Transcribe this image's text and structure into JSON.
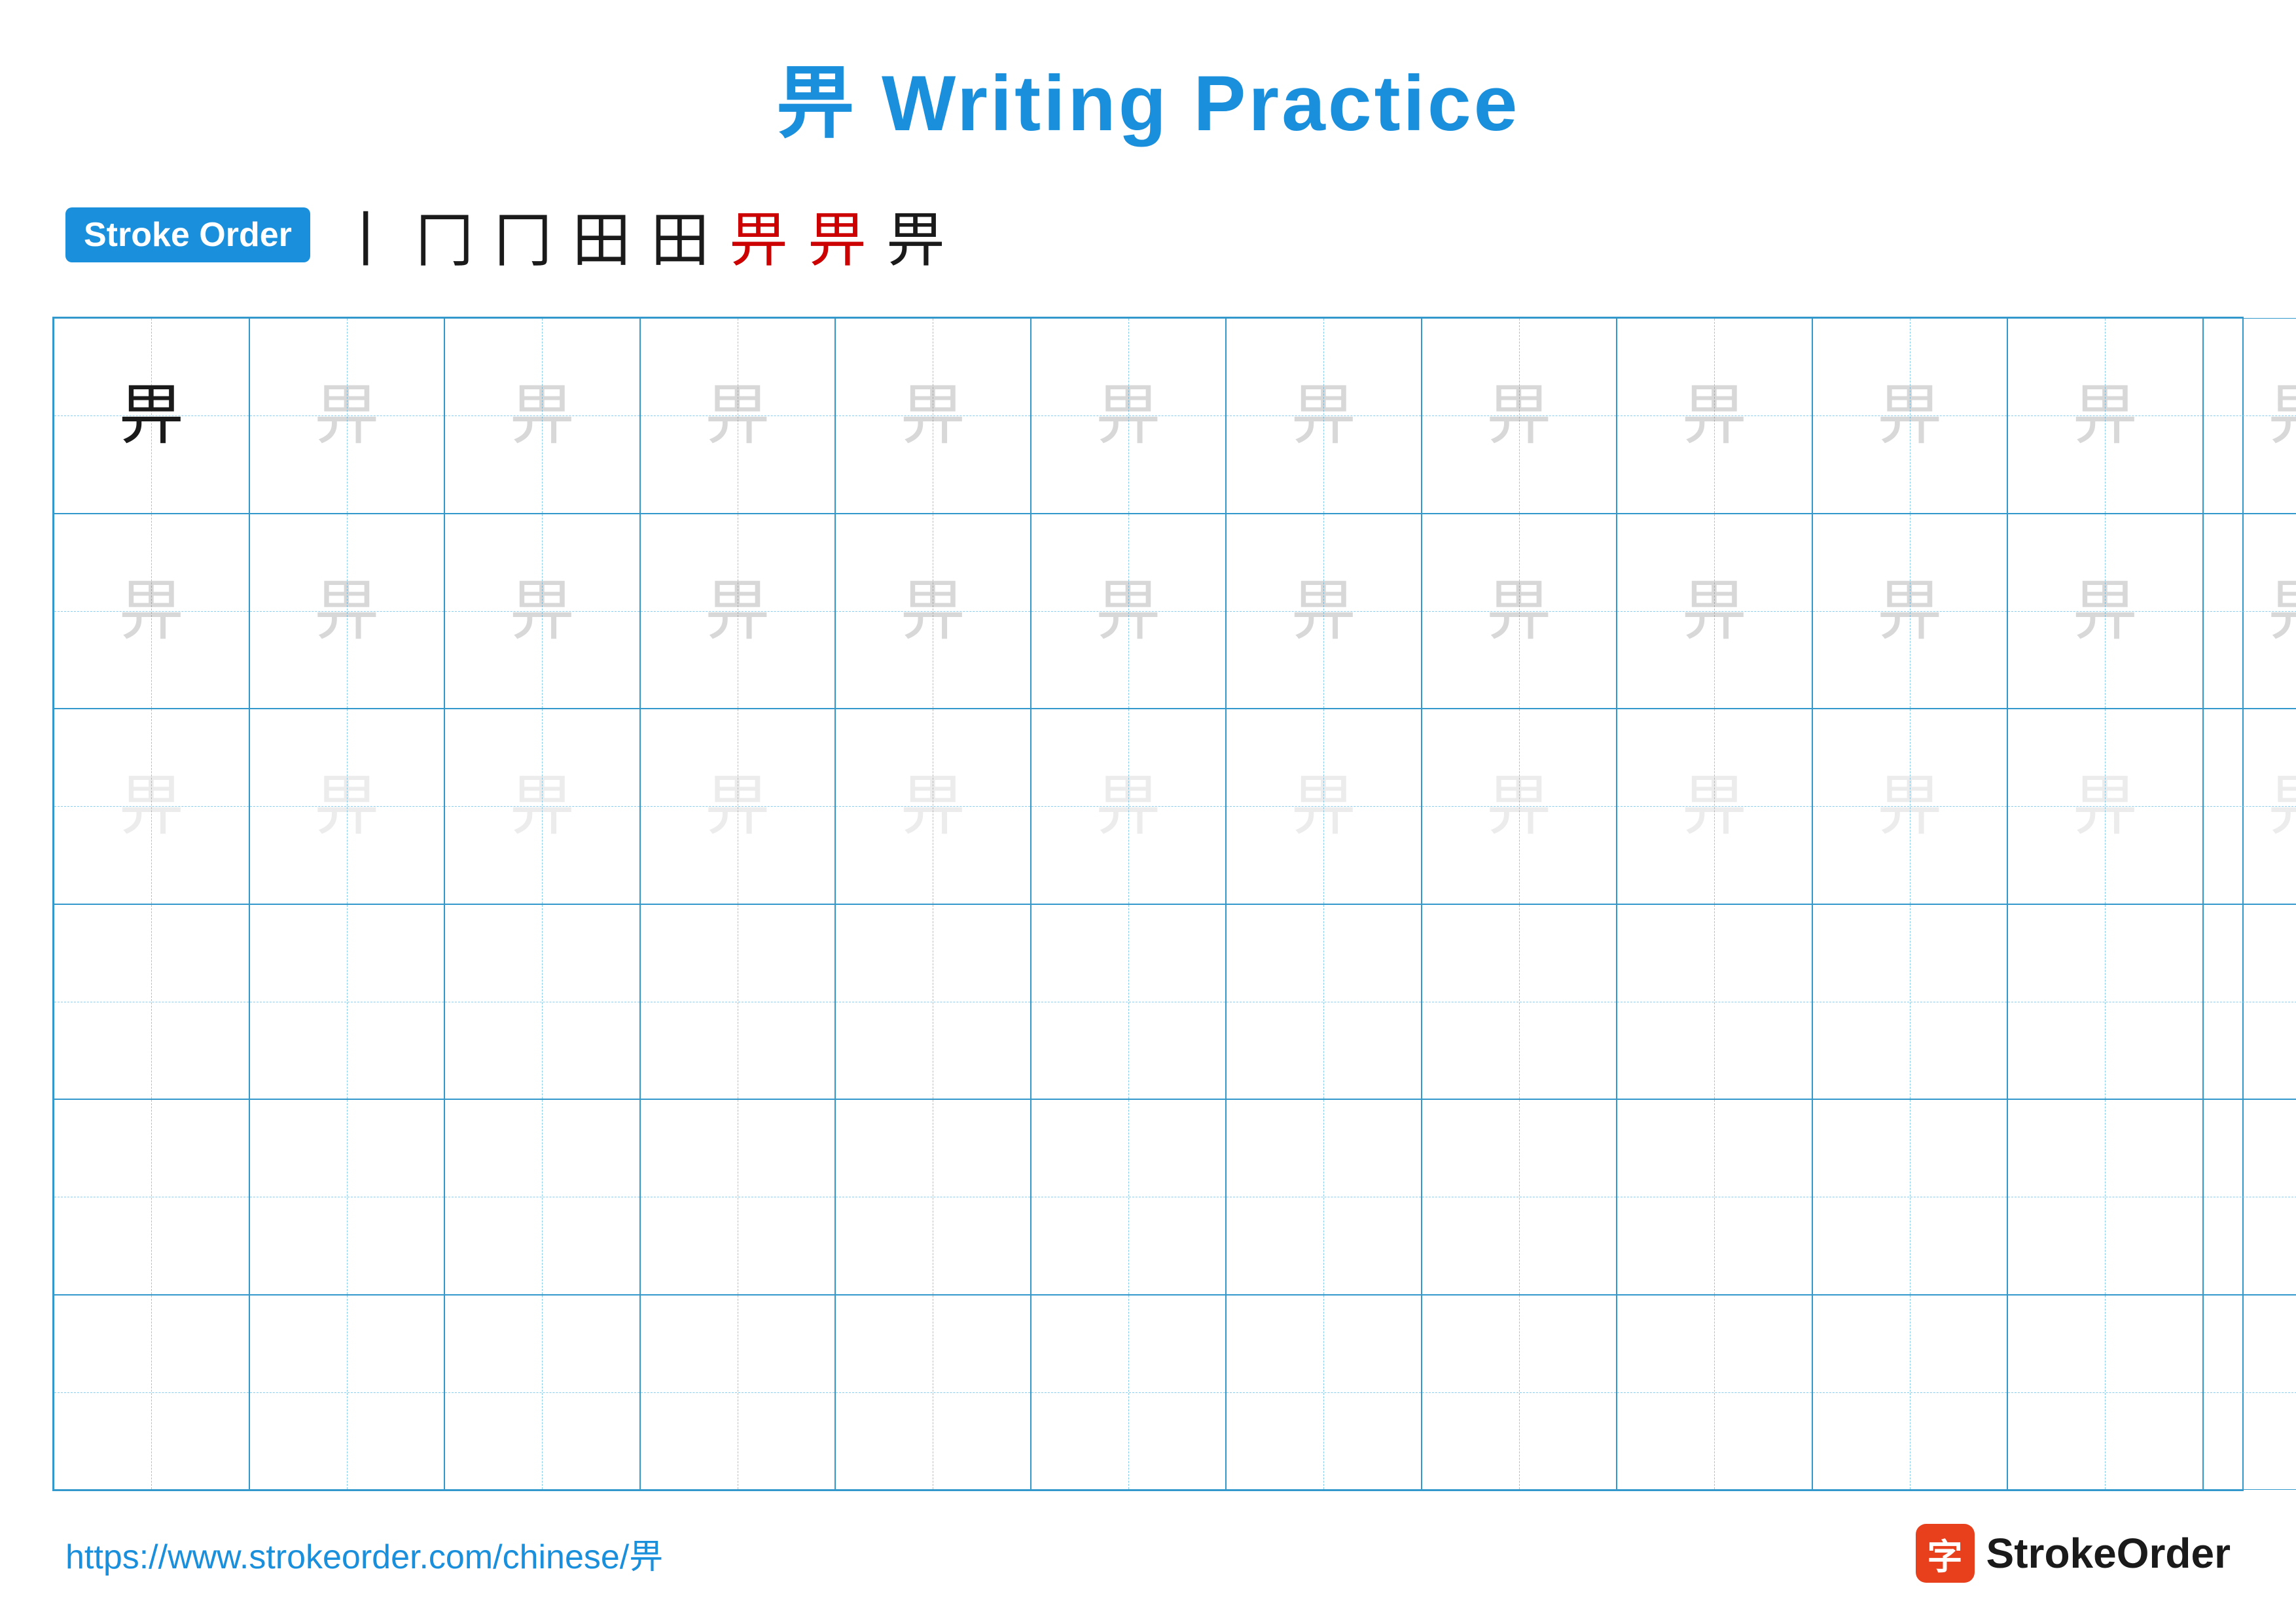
{
  "title": {
    "character": "畀",
    "text": " Writing Practice",
    "full": "畀 Writing Practice"
  },
  "stroke_order": {
    "badge_label": "Stroke Order",
    "strokes": [
      "丨",
      "冂",
      "冂",
      "田",
      "田",
      "畀",
      "畀",
      "畀"
    ]
  },
  "grid": {
    "cols": 13,
    "rows": 6,
    "character": "畀"
  },
  "footer": {
    "url": "https://www.strokeorder.com/chinese/畀",
    "logo_text": "StrokeOrder",
    "logo_char": "字"
  }
}
